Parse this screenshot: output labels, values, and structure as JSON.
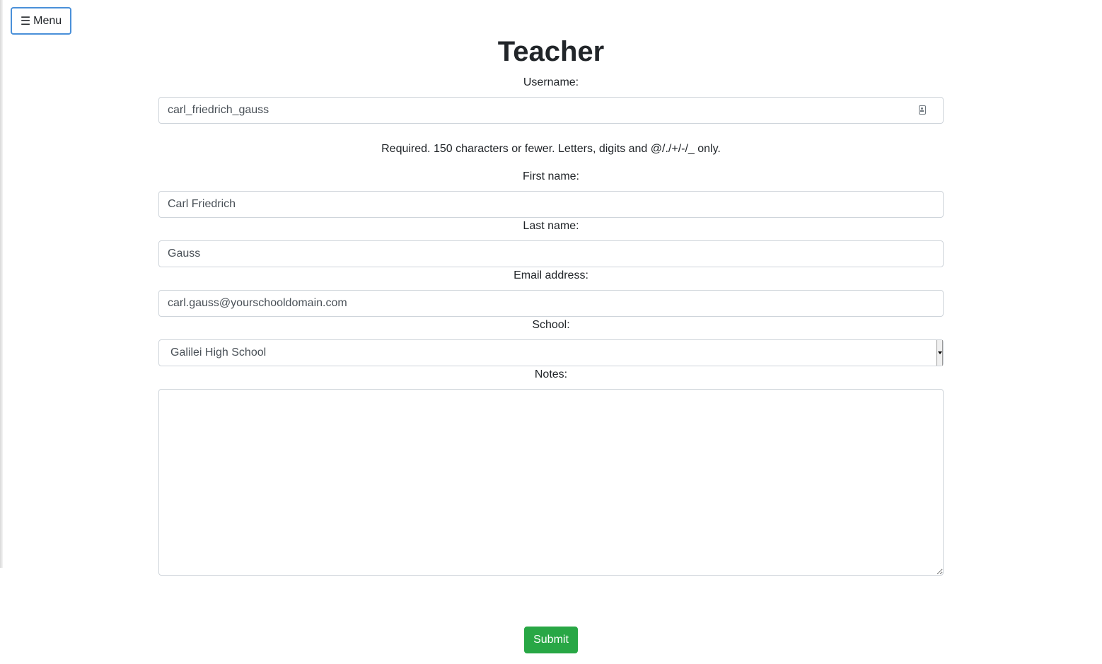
{
  "menu": {
    "icon": "hamburger-icon",
    "icon_glyph": "☰",
    "label": "Menu"
  },
  "page_title": "Teacher",
  "form": {
    "username": {
      "label": "Username:",
      "value": "carl_friedrich_gauss",
      "icon": "contact-card-icon",
      "help_text": "Required. 150 characters or fewer. Letters, digits and @/./+/-/_ only."
    },
    "first_name": {
      "label": "First name:",
      "value": "Carl Friedrich"
    },
    "last_name": {
      "label": "Last name:",
      "value": "Gauss"
    },
    "email": {
      "label": "Email address:",
      "value": "carl.gauss@yourschooldomain.com"
    },
    "school": {
      "label": "School:",
      "selected": "Galilei High School"
    },
    "notes": {
      "label": "Notes:",
      "value": ""
    },
    "submit_label": "Submit"
  },
  "colors": {
    "submit_green": "#28a745",
    "menu_border_blue": "#4a90d9",
    "input_border": "#ced4da"
  }
}
